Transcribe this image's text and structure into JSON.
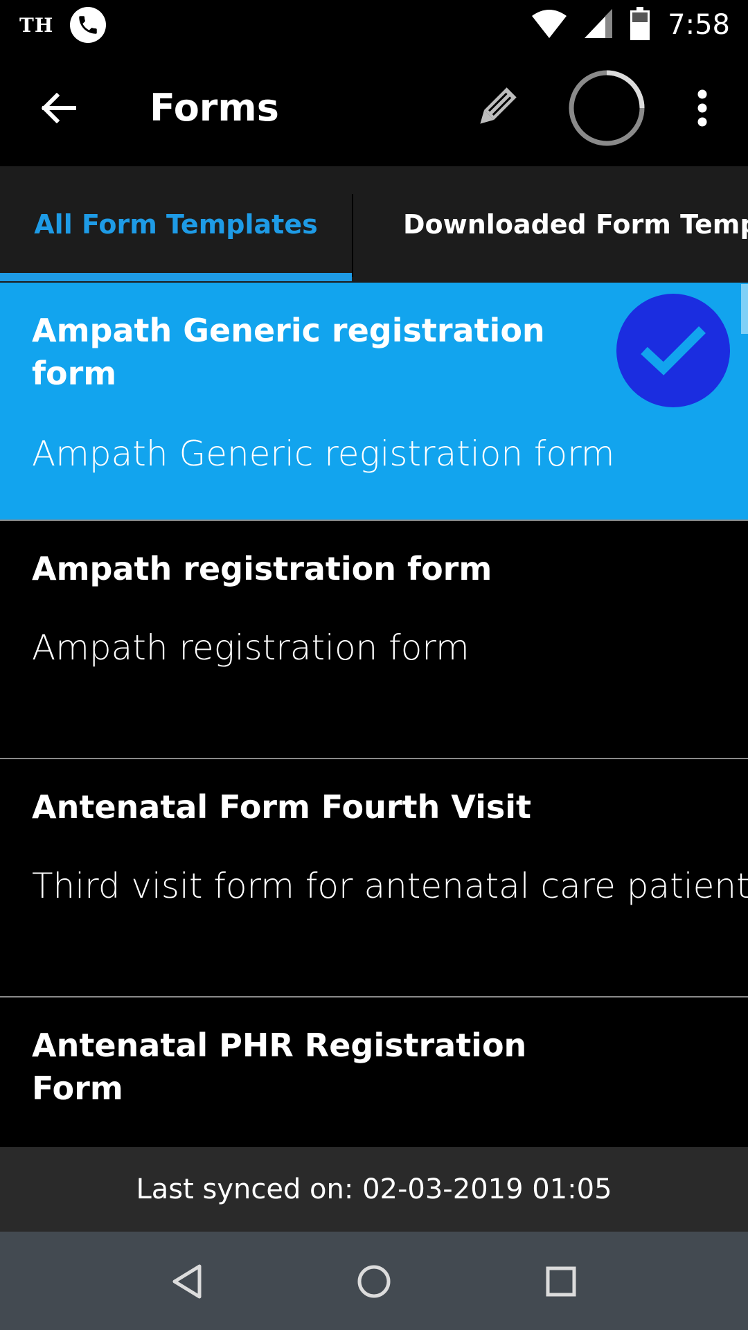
{
  "status_bar": {
    "carrier": "TH",
    "time": "7:58"
  },
  "app_bar": {
    "title": "Forms"
  },
  "tabs": [
    {
      "label": "All Form Templates",
      "active": true
    },
    {
      "label": "Downloaded Form Templates",
      "active": false
    }
  ],
  "forms": [
    {
      "title": "Ampath Generic registration form",
      "description": "Ampath Generic registration form",
      "selected": true
    },
    {
      "title": "Ampath registration form",
      "description": "Ampath registration form",
      "selected": false
    },
    {
      "title": "Antenatal Form Fourth Visit",
      "description": "Third visit form for antenatal care patients",
      "selected": false
    },
    {
      "title": "Antenatal PHR  Registration Form",
      "description": "",
      "selected": false
    }
  ],
  "sync": {
    "text": "Last synced on: 02-03-2019 01:05"
  },
  "colors": {
    "accent": "#1e9be6",
    "selected_row": "#12a4ee",
    "check_badge": "#1b2de0",
    "nav_bar": "#434a51"
  },
  "icons": [
    "phone-icon",
    "wifi-icon",
    "signal-icon",
    "battery-icon",
    "back-arrow-icon",
    "edit-pencil-icon",
    "loading-spinner-icon",
    "overflow-menu-icon",
    "checkmark-icon",
    "nav-back-icon",
    "nav-home-icon",
    "nav-recents-icon"
  ]
}
